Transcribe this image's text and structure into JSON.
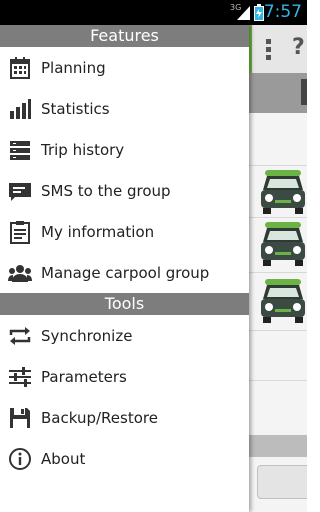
{
  "status_bar": {
    "network": "3G",
    "time": "7:57"
  },
  "drawer": {
    "sections": [
      {
        "title": "Features",
        "items": [
          {
            "label": "Planning",
            "icon": "calendar-icon"
          },
          {
            "label": "Statistics",
            "icon": "bar-chart-icon"
          },
          {
            "label": "Trip history",
            "icon": "list-icon"
          },
          {
            "label": "SMS to the group",
            "icon": "message-icon"
          },
          {
            "label": "My information",
            "icon": "clipboard-icon"
          },
          {
            "label": "Manage carpool group",
            "icon": "group-icon"
          }
        ]
      },
      {
        "title": "Tools",
        "items": [
          {
            "label": "Synchronize",
            "icon": "sync-icon"
          },
          {
            "label": "Parameters",
            "icon": "sliders-icon"
          },
          {
            "label": "Backup/Restore",
            "icon": "save-icon"
          },
          {
            "label": "About",
            "icon": "info-icon"
          }
        ]
      }
    ]
  },
  "main": {
    "help_label": "?"
  },
  "colors": {
    "accent": "#6ab344",
    "header": "#7d7d7d",
    "clock": "#33b5e5"
  }
}
